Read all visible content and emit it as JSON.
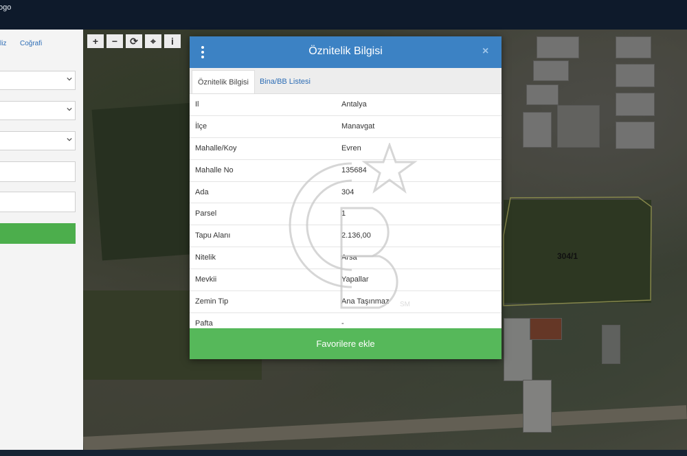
{
  "topbar": {
    "logo_text": "ogo"
  },
  "left_panel": {
    "tabs": [
      "liz",
      "Coğrafi"
    ]
  },
  "map_tools": [
    "+",
    "−",
    "⟳",
    "⌖",
    "i"
  ],
  "parcel": {
    "label": "304/1",
    "outline_color": "#d7d97a"
  },
  "modal": {
    "title": "Öznitelik Bilgisi",
    "close": "×",
    "tabs": [
      {
        "label": "Öznitelik Bilgisi",
        "active": true
      },
      {
        "label": "Bina/BB Listesi",
        "active": false
      }
    ],
    "rows": [
      {
        "key": "Il",
        "value": "Antalya"
      },
      {
        "key": "İlçe",
        "value": "Manavgat"
      },
      {
        "key": "Mahalle/Koy",
        "value": "Evren"
      },
      {
        "key": "Mahalle No",
        "value": "135684"
      },
      {
        "key": "Ada",
        "value": "304"
      },
      {
        "key": "Parsel",
        "value": "1"
      },
      {
        "key": "Tapu Alanı",
        "value": "2.136,00"
      },
      {
        "key": "Nitelik",
        "value": "Arsa"
      },
      {
        "key": "Mevkii",
        "value": "Yapallar"
      },
      {
        "key": "Zemin Tip",
        "value": "Ana Taşınmaz"
      },
      {
        "key": "Pafta",
        "value": "-"
      }
    ],
    "favorite_button": "Favorilere ekle"
  },
  "watermark": {
    "mark": "SM"
  },
  "colors": {
    "header_blue": "#3c82c4",
    "button_green": "#56b85a",
    "link_blue": "#2d6db5"
  }
}
